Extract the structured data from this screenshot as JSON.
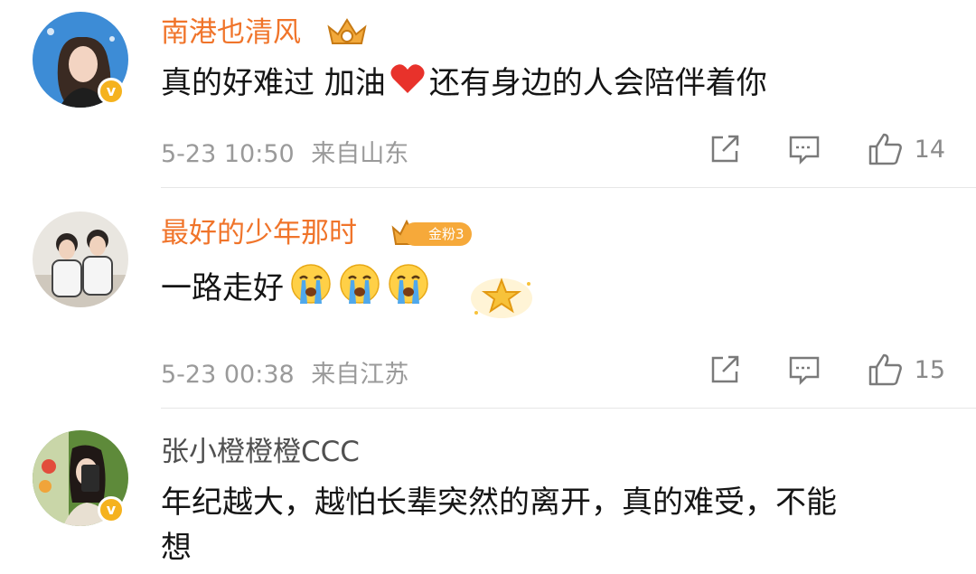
{
  "comments": [
    {
      "username": "南港也清风",
      "text_before_emoji": "真的好难过 加油",
      "text_after_emoji": "还有身边的人会陪伴着你",
      "timestamp": "5-23 10:50",
      "location": "来自山东",
      "likes": "14",
      "verified": true,
      "verified_mark": "v",
      "accent": "#f0742a"
    },
    {
      "username": "最好的少年那时",
      "badge_text": "金粉3",
      "text": "一路走好",
      "timestamp": "5-23 00:38",
      "location": "来自江苏",
      "likes": "15",
      "verified": false,
      "accent": "#f0742a"
    },
    {
      "username": "张小橙橙橙CCC",
      "text_line1": "年纪越大，越怕长辈突然的离开，真的难受，不能",
      "text_line2": "想",
      "verified": true,
      "verified_mark": "v"
    }
  ],
  "icons": [
    "share-icon",
    "comment-icon",
    "like-icon",
    "crown-icon",
    "heart-emoji",
    "crying-emoji"
  ],
  "colors": {
    "vip_name": "#f0742a",
    "verified_badge": "#f5b21e",
    "meta": "#9a9a9a"
  }
}
